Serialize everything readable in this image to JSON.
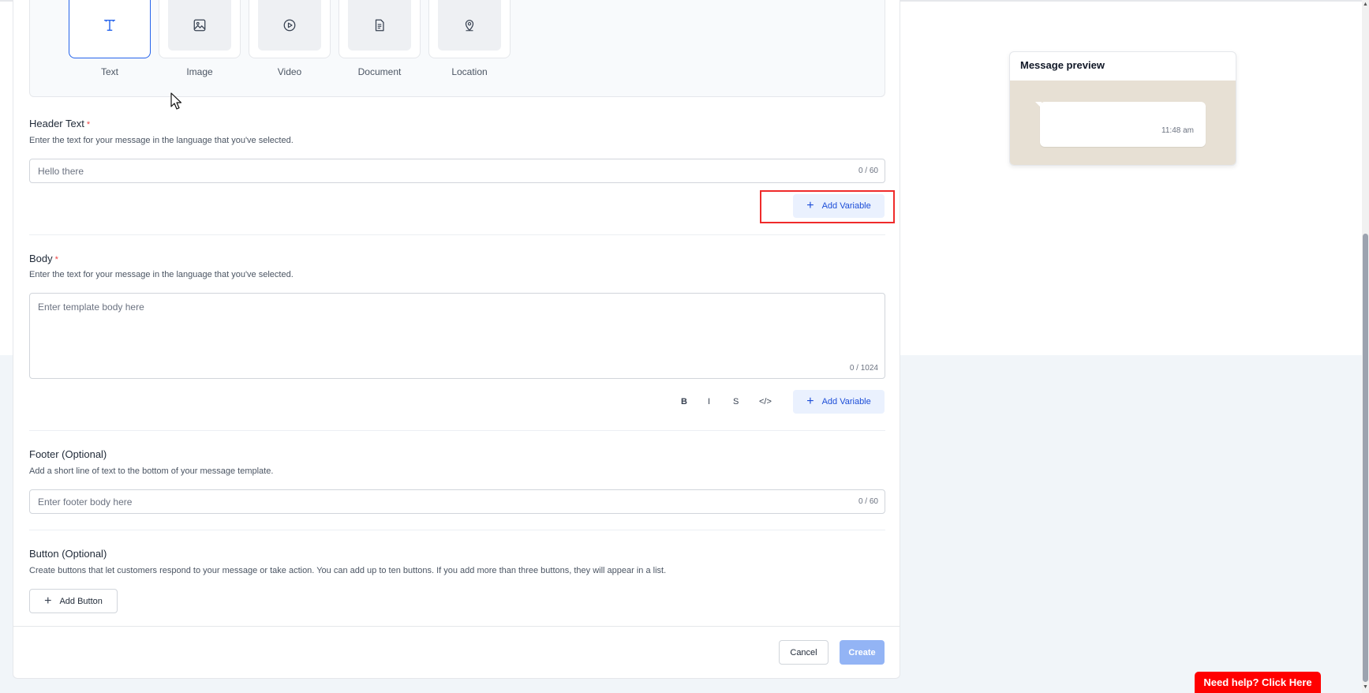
{
  "media_types": [
    {
      "label": "Text",
      "icon": "text-type-icon",
      "selected": true
    },
    {
      "label": "Image",
      "icon": "image-icon",
      "selected": false
    },
    {
      "label": "Video",
      "icon": "play-circle-icon",
      "selected": false
    },
    {
      "label": "Document",
      "icon": "document-icon",
      "selected": false
    },
    {
      "label": "Location",
      "icon": "map-pin-icon",
      "selected": false
    }
  ],
  "header_text": {
    "title": "Header Text",
    "required_mark": "*",
    "description": "Enter the text for your message in the language that you've selected.",
    "placeholder": "Hello there",
    "counter": "0 / 60",
    "add_variable_label": "Add Variable"
  },
  "body": {
    "title": "Body",
    "required_mark": "*",
    "description": "Enter the text for your message in the language that you've selected.",
    "placeholder": "Enter template body here",
    "counter": "0 / 1024",
    "format_bold": "B",
    "format_italic": "I",
    "format_strike": "S",
    "format_code": "</>",
    "add_variable_label": "Add Variable"
  },
  "footer": {
    "title": "Footer (Optional)",
    "description": "Add a short line of text to the bottom of your message template.",
    "placeholder": "Enter footer body here",
    "counter": "0 / 60"
  },
  "buttons": {
    "title": "Button (Optional)",
    "description": "Create buttons that let customers respond to your message or take action. You can add up to ten buttons. If you add more than three buttons, they will appear in a list.",
    "add_button_label": "Add Button"
  },
  "actions": {
    "cancel_label": "Cancel",
    "create_label": "Create"
  },
  "preview": {
    "title": "Message preview",
    "time": "11:48 am"
  },
  "help": {
    "label": "Need help? Click Here"
  },
  "colors": {
    "accent": "#2563eb",
    "help_red": "#ff0000",
    "create_disabled": "#93b4f5",
    "highlight": "#ef2b2b"
  }
}
